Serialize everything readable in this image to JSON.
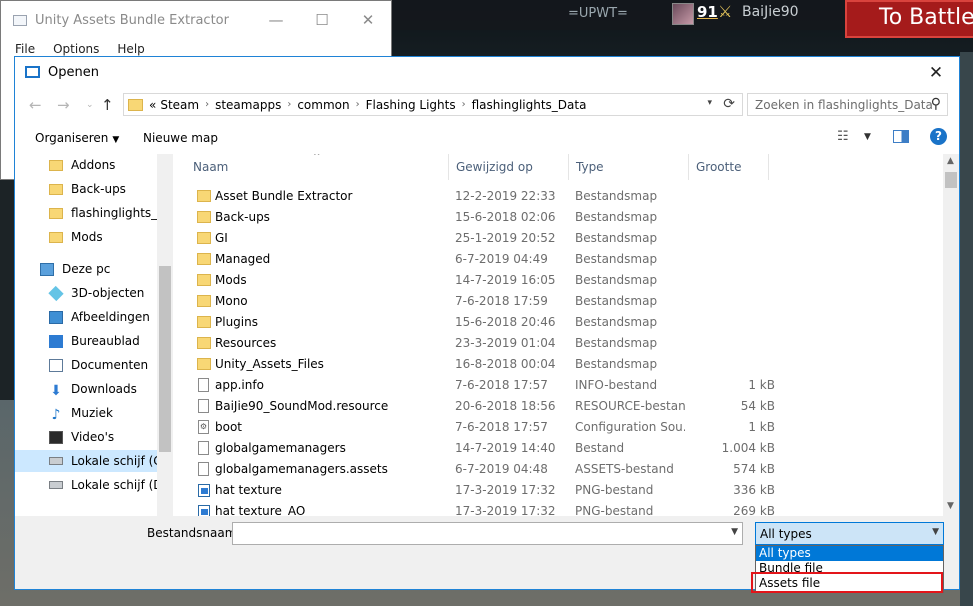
{
  "hud": {
    "upwt": "=UPWT=",
    "number": "91",
    "player": "BaiJie90",
    "battle_button": "To Battle"
  },
  "parent_window": {
    "title": "Unity Assets Bundle Extractor",
    "menu": [
      "File",
      "Options",
      "Help"
    ]
  },
  "dialog": {
    "title": "Openen",
    "breadcrumb_prefix": "«",
    "breadcrumb": [
      "Steam",
      "steamapps",
      "common",
      "Flashing Lights",
      "flashinglights_Data"
    ],
    "search_placeholder": "Zoeken in flashinglights_Data",
    "toolbar": {
      "organise": "Organiseren",
      "new_folder": "Nieuwe map"
    },
    "nav_items": [
      {
        "label": "Addons",
        "icon": "folder-icon"
      },
      {
        "label": "Back-ups",
        "icon": "folder-icon"
      },
      {
        "label": "flashinglights_Data",
        "icon": "folder-icon"
      },
      {
        "label": "Mods",
        "icon": "folder-icon"
      },
      {
        "label": "Deze pc",
        "icon": "computer-icon"
      },
      {
        "label": "3D-objecten",
        "icon": "cube-icon"
      },
      {
        "label": "Afbeeldingen",
        "icon": "pictures-icon"
      },
      {
        "label": "Bureaublad",
        "icon": "desktop-icon"
      },
      {
        "label": "Documenten",
        "icon": "documents-icon"
      },
      {
        "label": "Downloads",
        "icon": "download-icon"
      },
      {
        "label": "Muziek",
        "icon": "music-icon"
      },
      {
        "label": "Video's",
        "icon": "video-icon"
      },
      {
        "label": "Lokale schijf (C:)",
        "icon": "drive-icon"
      },
      {
        "label": "Lokale schijf (D:)",
        "icon": "drive-icon"
      }
    ],
    "columns": {
      "name": "Naam",
      "date": "Gewijzigd op",
      "type": "Type",
      "size": "Grootte"
    },
    "files": [
      {
        "name": "Asset Bundle Extractor",
        "date": "12-2-2019 22:33",
        "type": "Bestandsmap",
        "size": "",
        "icon": "folder"
      },
      {
        "name": "Back-ups",
        "date": "15-6-2018 02:06",
        "type": "Bestandsmap",
        "size": "",
        "icon": "folder"
      },
      {
        "name": "GI",
        "date": "25-1-2019 20:52",
        "type": "Bestandsmap",
        "size": "",
        "icon": "folder"
      },
      {
        "name": "Managed",
        "date": "6-7-2019 04:49",
        "type": "Bestandsmap",
        "size": "",
        "icon": "folder"
      },
      {
        "name": "Mods",
        "date": "14-7-2019 16:05",
        "type": "Bestandsmap",
        "size": "",
        "icon": "folder"
      },
      {
        "name": "Mono",
        "date": "7-6-2018 17:59",
        "type": "Bestandsmap",
        "size": "",
        "icon": "folder"
      },
      {
        "name": "Plugins",
        "date": "15-6-2018 20:46",
        "type": "Bestandsmap",
        "size": "",
        "icon": "folder"
      },
      {
        "name": "Resources",
        "date": "23-3-2019 01:04",
        "type": "Bestandsmap",
        "size": "",
        "icon": "folder"
      },
      {
        "name": "Unity_Assets_Files",
        "date": "16-8-2018 00:04",
        "type": "Bestandsmap",
        "size": "",
        "icon": "folder"
      },
      {
        "name": "app.info",
        "date": "7-6-2018 17:57",
        "type": "INFO-bestand",
        "size": "1 kB",
        "icon": "file"
      },
      {
        "name": "BaiJie90_SoundMod.resource",
        "date": "20-6-2018 18:56",
        "type": "RESOURCE-bestand",
        "size": "54 kB",
        "icon": "file"
      },
      {
        "name": "boot",
        "date": "7-6-2018 17:57",
        "type": "Configuration Sou...",
        "size": "1 kB",
        "icon": "gear"
      },
      {
        "name": "globalgamemanagers",
        "date": "14-7-2019 14:40",
        "type": "Bestand",
        "size": "1.004 kB",
        "icon": "file"
      },
      {
        "name": "globalgamemanagers.assets",
        "date": "6-7-2019 04:48",
        "type": "ASSETS-bestand",
        "size": "574 kB",
        "icon": "file"
      },
      {
        "name": "hat texture",
        "date": "17-3-2019 17:32",
        "type": "PNG-bestand",
        "size": "336 kB",
        "icon": "image"
      },
      {
        "name": "hat texture_AO",
        "date": "17-3-2019 17:32",
        "type": "PNG-bestand",
        "size": "269 kB",
        "icon": "image"
      }
    ],
    "filename_label": "Bestandsnaam:",
    "filename_value": "",
    "file_type_selected": "All types",
    "file_type_options": [
      "All types",
      "Bundle file",
      "Assets file"
    ]
  }
}
